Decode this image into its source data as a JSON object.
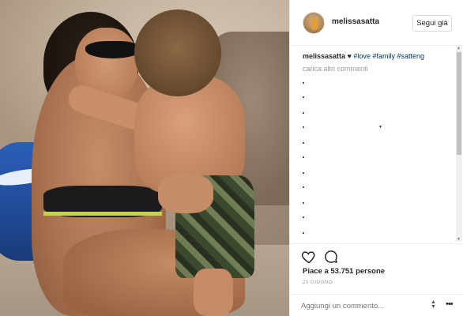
{
  "post": {
    "username": "melissasatta",
    "follow_label": "Segui già",
    "caption_user": "melissasatta",
    "caption_heart": " ♥ ",
    "caption_tags": [
      "#love",
      "#family",
      "#satteng"
    ],
    "load_more": "carica altri commenti",
    "likes": "Piace a 53.751 persone",
    "date": "20 GIUGNO",
    "comment_placeholder": "Aggiungi un commento..."
  },
  "icons": {
    "heart": "heart-icon",
    "comment": "comment-icon",
    "more": "more-icon"
  },
  "colors": {
    "tag": "#003569",
    "muted": "#999999",
    "border": "#dbdbdb"
  }
}
